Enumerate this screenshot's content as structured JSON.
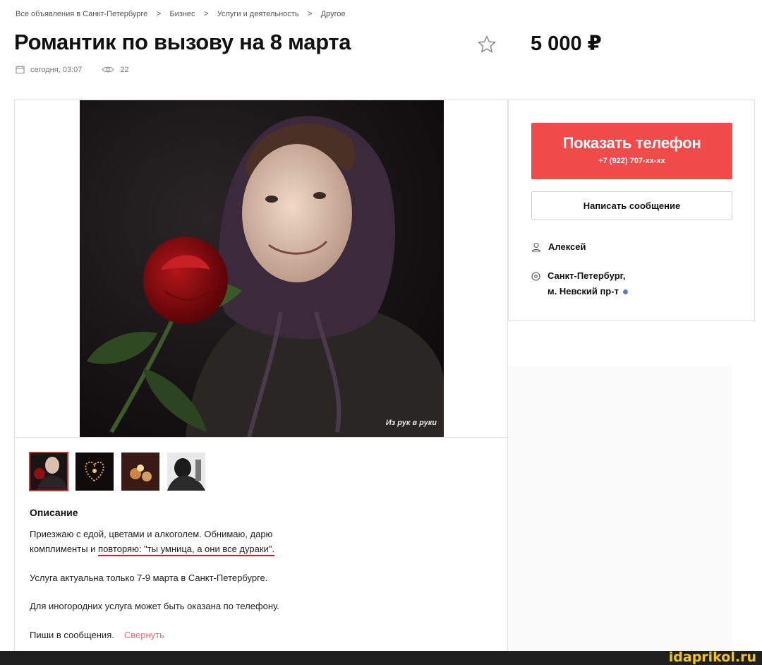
{
  "breadcrumb": {
    "items": [
      "Все объявления в Санкт-Петербурге",
      "Бизнес",
      "Услуги и деятельность",
      "Другое"
    ],
    "separator": ">"
  },
  "listing": {
    "title": "Романтик по вызову на 8 марта",
    "price": "5 000 ₽",
    "date": "сегодня, 03:07",
    "views": "22"
  },
  "gallery": {
    "watermark": "Из рук в руки",
    "thumbnails": [
      "thumb-selfie-rose",
      "thumb-heart-lights",
      "thumb-candles",
      "thumb-couple"
    ]
  },
  "contact": {
    "show_phone_label": "Показать телефон",
    "phone_masked": "+7 (922) 707-xx-xx",
    "write_message_label": "Написать сообщение",
    "seller_name": "Алексей",
    "location_city": "Санкт-Петербург,",
    "location_metro": "м. Невский пр-т"
  },
  "description": {
    "heading": "Описание",
    "line1": "Приезжаю с едой, цветами и алкоголем. Обнимаю, дарю",
    "line2_prefix": "комплименты и ",
    "line2_underlined": "повторяю: \"ты умница, а они все дураки\".",
    "para2": "Услуга актуальна только 7-9 марта в Санкт-Петербурге.",
    "para3": "Для иногородних услуга может быть оказана по телефону.",
    "para4": "Пиши в сообщения.",
    "collapse_label": "Свернуть"
  },
  "footer": {
    "site_mark": "idaprikol.ru"
  },
  "icons": {
    "favorite": "star-outline-icon",
    "date": "calendar-icon",
    "views": "eye-icon",
    "seller": "user-icon",
    "location": "map-pin-icon"
  },
  "colors": {
    "accent": "#f04a4a",
    "link": "#f06d6d",
    "underline": "#d0202a",
    "metro": "#5b7fc2",
    "watermark_bar": "#1f1f1f",
    "site_mark": "#f5c518"
  }
}
